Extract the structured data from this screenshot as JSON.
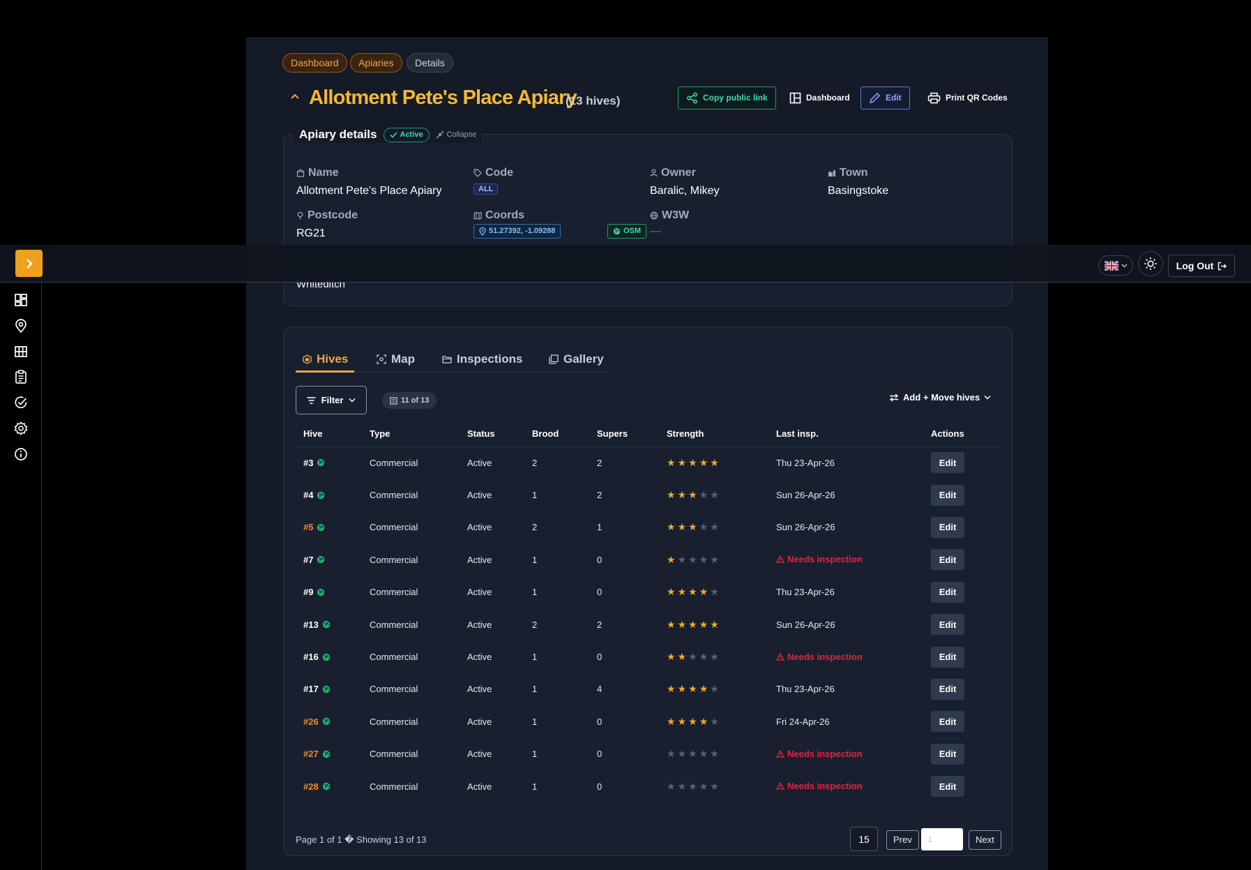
{
  "breadcrumbs": [
    "Dashboard",
    "Apiaries",
    "Details"
  ],
  "header": {
    "title": "Allotment Pete's Place Apiary",
    "hive_count": "(13 hives)",
    "copy_link_label": "Copy public link",
    "dashboard_label": "Dashboard",
    "edit_label": "Edit",
    "print_label": "Print QR Codes"
  },
  "details": {
    "legend": "Apiary details",
    "status": "Active",
    "collapse_label": "Collapse",
    "name_label": "Name",
    "name_value": "Allotment Pete's Place Apiary",
    "code_label": "Code",
    "code_value": "ALL",
    "owner_label": "Owner",
    "owner_value": "Baralic, Mikey",
    "town_label": "Town",
    "town_value": "Basingstoke",
    "postcode_label": "Postcode",
    "postcode_value": "RG21",
    "coords_label": "Coords",
    "coords_value": "51.27392, -1.09288",
    "osm_label": "OSM",
    "w3w_label": "W3W",
    "w3w_value": "—",
    "location_value": "Whiteditch"
  },
  "tabs": [
    "Hives",
    "Map",
    "Inspections",
    "Gallery"
  ],
  "toolbar": {
    "filter_label": "Filter",
    "count_label": "11 of 13",
    "add_move_label": "Add + Move hives"
  },
  "table": {
    "headers": [
      "Hive",
      "Type",
      "Status",
      "Brood",
      "Supers",
      "Strength",
      "Last insp.",
      "Actions"
    ],
    "rows": [
      {
        "hive": "#3",
        "type": "Commercial",
        "status": "Active",
        "brood": "2",
        "supers": "2",
        "strength": 5,
        "last": "Thu 23-Apr-26",
        "action": "Edit"
      },
      {
        "hive": "#4",
        "type": "Commercial",
        "status": "Active",
        "brood": "1",
        "supers": "2",
        "strength": 3,
        "last": "Sun 26-Apr-26",
        "action": "Edit"
      },
      {
        "hive": "#5",
        "type": "Commercial",
        "status": "Active",
        "brood": "2",
        "supers": "1",
        "strength": 3,
        "last": "Sun 26-Apr-26",
        "action": "Edit",
        "flag": true
      },
      {
        "hive": "#7",
        "type": "Commercial",
        "status": "Active",
        "brood": "1",
        "supers": "0",
        "strength": 1,
        "last": "Needs inspection",
        "action": "Edit",
        "needs": true
      },
      {
        "hive": "#9",
        "type": "Commercial",
        "status": "Active",
        "brood": "1",
        "supers": "0",
        "strength": 4,
        "last": "Thu 23-Apr-26",
        "action": "Edit"
      },
      {
        "hive": "#13",
        "type": "Commercial",
        "status": "Active",
        "brood": "2",
        "supers": "2",
        "strength": 5,
        "last": "Sun 26-Apr-26",
        "action": "Edit"
      },
      {
        "hive": "#16",
        "type": "Commercial",
        "status": "Active",
        "brood": "1",
        "supers": "0",
        "strength": 2,
        "last": "Needs inspection",
        "action": "Edit",
        "needs": true
      },
      {
        "hive": "#17",
        "type": "Commercial",
        "status": "Active",
        "brood": "1",
        "supers": "4",
        "strength": 4,
        "last": "Thu 23-Apr-26",
        "action": "Edit"
      },
      {
        "hive": "#26",
        "type": "Commercial",
        "status": "Active",
        "brood": "1",
        "supers": "0",
        "strength": 4,
        "last": "Fri 24-Apr-26",
        "action": "Edit",
        "flag": true
      },
      {
        "hive": "#27",
        "type": "Commercial",
        "status": "Active",
        "brood": "1",
        "supers": "0",
        "strength": 0,
        "last": "Needs inspection",
        "action": "Edit",
        "needs": true,
        "flag": true
      },
      {
        "hive": "#28",
        "type": "Commercial",
        "status": "Active",
        "brood": "1",
        "supers": "0",
        "strength": 0,
        "last": "Needs inspection",
        "action": "Edit",
        "needs": true,
        "flag": true
      }
    ]
  },
  "pagination": {
    "info": "Page 1 of 1 � Showing 13 of 13",
    "page_size": "15",
    "prev_label": "Prev",
    "page_input_placeholder": "1",
    "next_label": "Next"
  },
  "topbar": {
    "logout_label": "Log Out"
  },
  "sidebar": {
    "icons": [
      "dashboard-icon",
      "map-pin-icon",
      "grid-icon",
      "clipboard-icon",
      "check-circle-icon",
      "settings-icon",
      "info-icon"
    ]
  },
  "colors": {
    "accent": "#f7b733",
    "active_green": "#34d37f",
    "warning_red": "#e02443",
    "star": "#f7a928",
    "panel_bg": "#141a26"
  }
}
